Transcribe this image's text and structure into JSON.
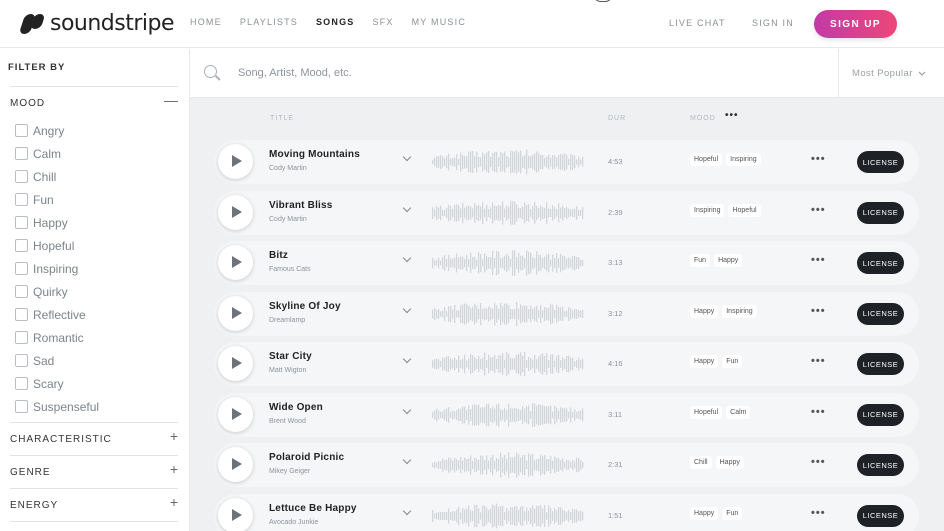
{
  "header": {
    "logo_text": "soundstripe",
    "nav": [
      "HOME",
      "PLAYLISTS",
      "SONGS",
      "SFX",
      "MY MUSIC"
    ],
    "active_nav": "SONGS",
    "live_chat": "LIVE CHAT",
    "sign_in": "SIGN IN",
    "sign_up": "SIGN UP"
  },
  "sidebar": {
    "filter_by": "FILTER BY",
    "sections": [
      {
        "label": "MOOD",
        "toggle": "—",
        "expanded": true
      },
      {
        "label": "CHARACTERISTIC",
        "toggle": "+"
      },
      {
        "label": "GENRE",
        "toggle": "+"
      },
      {
        "label": "ENERGY",
        "toggle": "+"
      }
    ],
    "moods": [
      "Angry",
      "Calm",
      "Chill",
      "Fun",
      "Happy",
      "Hopeful",
      "Inspiring",
      "Quirky",
      "Reflective",
      "Romantic",
      "Sad",
      "Scary",
      "Suspenseful"
    ]
  },
  "search": {
    "placeholder": "Song, Artist, Mood, etc.",
    "sort_label": "Most Popular"
  },
  "columns": {
    "title": "TITLE",
    "dur": "DUR",
    "mood": "MOOD",
    "mood_more": "•••"
  },
  "songs": [
    {
      "title": "Moving Mountains",
      "artist": "Cody Martin",
      "duration": "4:53",
      "tags": [
        "Hopeful",
        "Inspiring"
      ]
    },
    {
      "title": "Vibrant Bliss",
      "artist": "Cody Martin",
      "duration": "2:39",
      "tags": [
        "Inspiring",
        "Hopeful"
      ]
    },
    {
      "title": "Bitz",
      "artist": "Famous Cats",
      "duration": "3:13",
      "tags": [
        "Fun",
        "Happy"
      ]
    },
    {
      "title": "Skyline Of Joy",
      "artist": "Dreamlamp",
      "duration": "3:12",
      "tags": [
        "Happy",
        "Inspiring"
      ]
    },
    {
      "title": "Star City",
      "artist": "Matt Wigton",
      "duration": "4:16",
      "tags": [
        "Happy",
        "Fun"
      ]
    },
    {
      "title": "Wide Open",
      "artist": "Brent Wood",
      "duration": "3:11",
      "tags": [
        "Hopeful",
        "Calm"
      ]
    },
    {
      "title": "Polaroid Picnic",
      "artist": "Mikey Geiger",
      "duration": "2:31",
      "tags": [
        "Chill",
        "Happy"
      ]
    },
    {
      "title": "Lettuce Be Happy",
      "artist": "Avocado Junkie",
      "duration": "1:51",
      "tags": [
        "Happy",
        "Fun"
      ]
    }
  ],
  "license_label": "LICENSE",
  "more_label": "•••",
  "colors": {
    "signup_gradient_start": "#c33aa6",
    "signup_gradient_end": "#ec4779",
    "license_bg": "#1e2126",
    "waveform": "#d3d6da"
  }
}
